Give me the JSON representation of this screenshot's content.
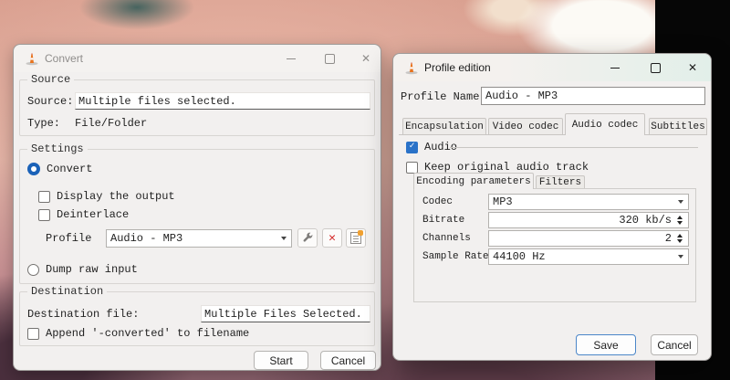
{
  "icons": {
    "close_glyph": "✕",
    "check_glyph": "✓",
    "delete_glyph": "✕"
  },
  "colors": {
    "accent_blue": "#2a72c8",
    "radio_blue": "#1b62b8",
    "delete_red": "#d42a2a",
    "cone_orange": "#e8731d",
    "new_profile_badge_orange": "#f0a030"
  },
  "convert": {
    "title": "Convert",
    "source": {
      "group_label": "Source",
      "source_label": "Source:",
      "source_value": "Multiple files selected.",
      "type_label": "Type:",
      "type_value": "File/Folder"
    },
    "settings": {
      "group_label": "Settings",
      "convert_radio_label": "Convert",
      "display_output_label": "Display the output",
      "deinterlace_label": "Deinterlace",
      "profile_label": "Profile",
      "profile_value": "Audio - MP3",
      "dump_raw_label": "Dump raw input"
    },
    "destination": {
      "group_label": "Destination",
      "file_label": "Destination file:",
      "file_value": "Multiple Files Selected.",
      "append_label": "Append '-converted' to filename"
    },
    "buttons": {
      "start": "Start",
      "cancel": "Cancel"
    }
  },
  "profile": {
    "title": "Profile edition",
    "name_label": "Profile Name",
    "name_value": "Audio - MP3",
    "tabs": {
      "encapsulation": "Encapsulation",
      "video_codec": "Video codec",
      "audio_codec": "Audio codec",
      "subtitles": "Subtitles"
    },
    "audio_label": "Audio",
    "keep_original_label": "Keep original audio track",
    "subtabs": {
      "encoding": "Encoding parameters",
      "filters": "Filters"
    },
    "fields": {
      "codec_label": "Codec",
      "codec_value": "MP3",
      "bitrate_label": "Bitrate",
      "bitrate_value": "320 kb/s",
      "channels_label": "Channels",
      "channels_value": "2",
      "samplerate_label": "Sample Rate",
      "samplerate_value": "44100 Hz"
    },
    "buttons": {
      "save": "Save",
      "cancel": "Cancel"
    }
  }
}
